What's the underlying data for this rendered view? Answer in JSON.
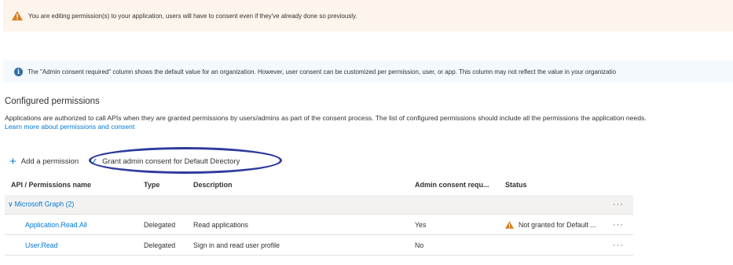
{
  "warning_banner": {
    "message": "You are editing permission(s) to your application, users will have to consent even if they've already done so previously."
  },
  "info_banner": {
    "message": "The \"Admin consent required\" column shows the default value for an organization. However, user consent can be customized per permission, user, or app. This column may not reflect the value in your organizatio"
  },
  "section": {
    "title": "Configured permissions",
    "description": "Applications are authorized to call APIs when they are granted permissions by users/admins as part of the consent process. The list of configured permissions should include all the permissions the application needs.",
    "learn_more": "Learn more about permissions and consent"
  },
  "toolbar": {
    "add_label": "Add a permission",
    "grant_label": "Grant admin consent for Default Directory"
  },
  "table": {
    "headers": {
      "name": "API / Permissions name",
      "type": "Type",
      "description": "Description",
      "admin": "Admin consent requ...",
      "status": "Status"
    },
    "group": {
      "label": "Microsoft Graph (2)",
      "more": "···"
    },
    "rows": [
      {
        "name": "Application.Read.All",
        "type": "Delegated",
        "description": "Read applications",
        "admin": "Yes",
        "status": "Not granted for Default ...",
        "more": "···"
      },
      {
        "name": "User.Read",
        "type": "Delegated",
        "description": "Sign in and read user profile",
        "admin": "No",
        "status": "",
        "more": "···"
      }
    ]
  },
  "colors": {
    "accent": "#0078d4",
    "warning": "#d67f1f",
    "warning_bg": "#fdf4ec",
    "info_bg": "#f3f9fd",
    "annotation_oval": "#2f3a9c"
  }
}
